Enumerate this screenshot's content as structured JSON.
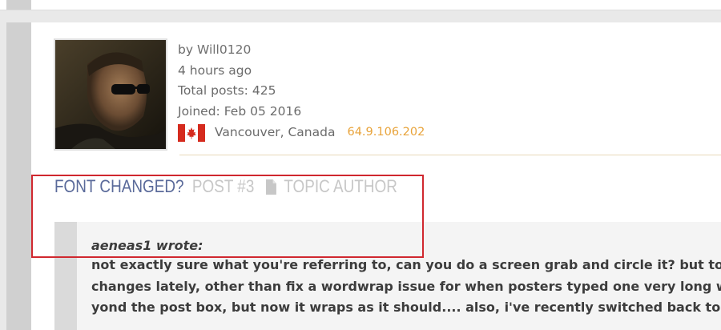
{
  "post": {
    "author": {
      "by_prefix": "by",
      "name": "Will0120",
      "time_ago": "4 hours ago",
      "total_posts_label": "Total posts:",
      "total_posts": "425",
      "joined_label": "Joined:",
      "joined": "Feb 05 2016",
      "flag": "canada-flag-icon",
      "location": "Vancouver, Canada",
      "ip": "64.9.106.202"
    },
    "title": {
      "subject": "FONT CHANGED?",
      "post_number": "POST #3",
      "author_tag": "TOPIC AUTHOR"
    },
    "quote": {
      "author": "aeneas1 wrote:",
      "lines": [
        "not exactly sure what you're referring to, can you do a screen grab and circle it? but to answer",
        "changes lately, other than fix a wordwrap issue for when posters typed one very long word w",
        "yond the post box, but now it wraps as it should.... also, i've recently switched back to firefox"
      ]
    }
  },
  "colors": {
    "subject": "#5a6a9a",
    "muted_title": "#c7c7c7",
    "ip": "#e8a33a",
    "highlight": "#d0282f"
  }
}
